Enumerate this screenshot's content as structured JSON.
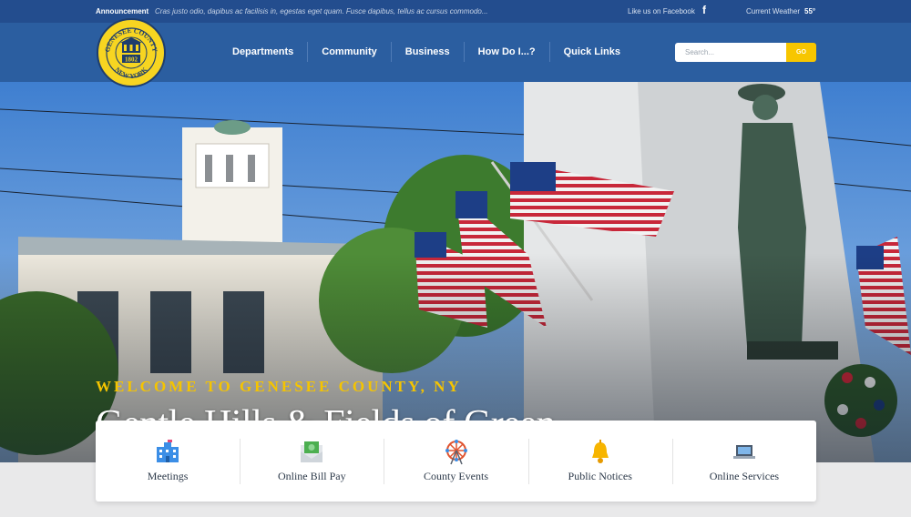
{
  "announcement": {
    "label": "Announcement",
    "text": "Cras justo odio, dapibus ac facilisis in, egestas eget quam. Fusce dapibus, tellus ac cursus commodo..."
  },
  "social": {
    "facebook_label": "Like us on Facebook",
    "facebook_icon": "f"
  },
  "weather": {
    "label": "Current Weather",
    "temp": "55°"
  },
  "logo": {
    "top_text": "GENESEE COUNTY",
    "bottom_text": "NEW YORK",
    "year": "1802"
  },
  "nav": {
    "items": [
      {
        "label": "Departments"
      },
      {
        "label": "Community"
      },
      {
        "label": "Business"
      },
      {
        "label": "How Do I...?"
      },
      {
        "label": "Quick Links"
      }
    ]
  },
  "search": {
    "placeholder": "Search...",
    "button_label": "GO"
  },
  "hero": {
    "kicker": "WELCOME TO GENESEE COUNTY, NY",
    "headline": "Gentle Hills & Fields of Green"
  },
  "quick_links": [
    {
      "label": "Meetings",
      "icon": "building-icon"
    },
    {
      "label": "Online Bill Pay",
      "icon": "money-envelope-icon"
    },
    {
      "label": "County Events",
      "icon": "ferris-wheel-icon"
    },
    {
      "label": "Public Notices",
      "icon": "bell-icon"
    },
    {
      "label": "Online Services",
      "icon": "laptop-icon"
    }
  ],
  "colors": {
    "topbar": "#234d8e",
    "header": "#2b5ea0",
    "accent_yellow": "#f5c400",
    "page_background": "#e9e9ea"
  }
}
